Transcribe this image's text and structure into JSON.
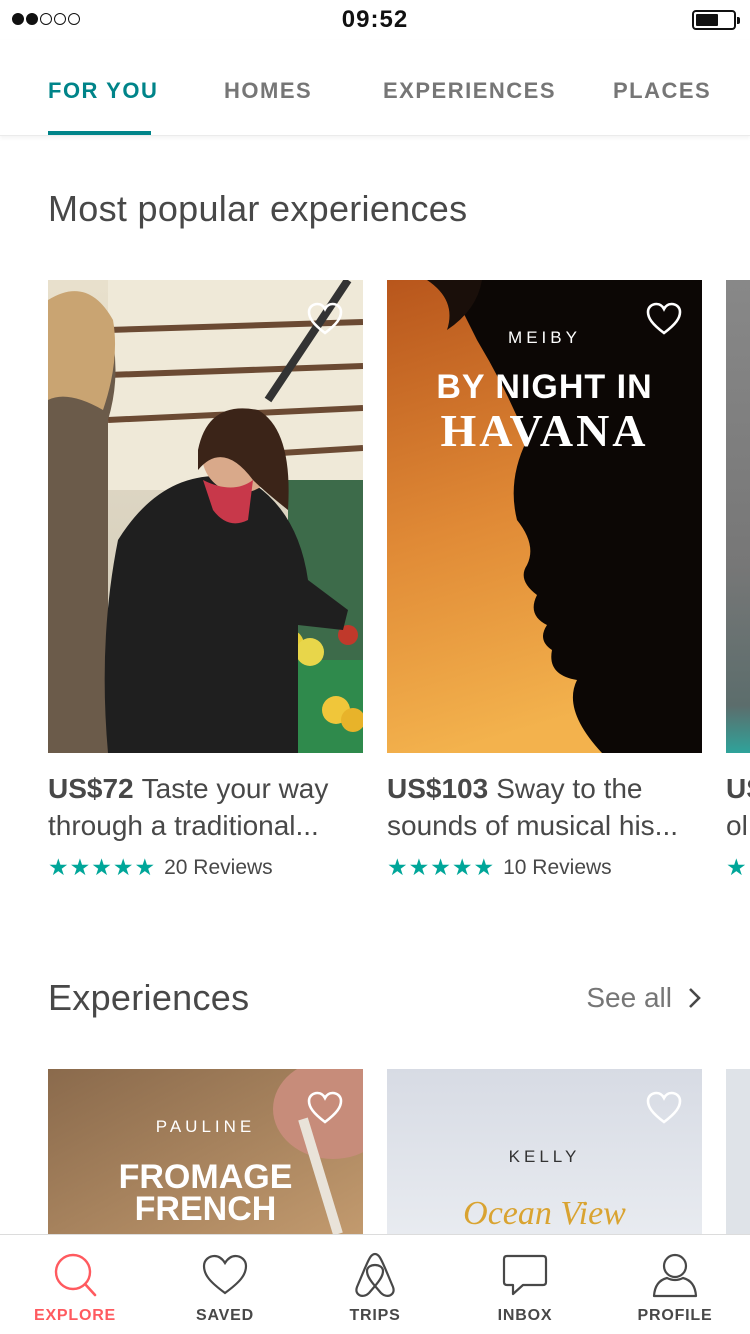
{
  "status_bar": {
    "time": "09:52"
  },
  "tabs": [
    {
      "label": "FOR YOU",
      "active": true
    },
    {
      "label": "HOMES",
      "active": false
    },
    {
      "label": "EXPERIENCES",
      "active": false
    },
    {
      "label": "PLACES",
      "active": false
    }
  ],
  "popular": {
    "title": "Most popular experiences",
    "cards": [
      {
        "price": "US$72",
        "title": "Taste your way through a traditional...",
        "stars": "★★★★★",
        "reviews": "20 Reviews"
      },
      {
        "price": "US$103",
        "title": "Sway to the sounds of musical his...",
        "stars": "★★★★★",
        "reviews": "10 Reviews",
        "host": "MEIBY",
        "line1": "BY NIGHT IN",
        "line2": "HAVANA"
      }
    ],
    "peek": {
      "price": "US",
      "title": "ol"
    }
  },
  "experiences": {
    "title": "Experiences",
    "see_all": "See all",
    "cards": [
      {
        "host": "PAULINE",
        "line1": "FROMAGE",
        "line2": "FRENCH"
      },
      {
        "host": "KELLY",
        "script": "Ocean View"
      }
    ]
  },
  "bottom_nav": [
    {
      "label": "EXPLORE",
      "icon": "search-icon",
      "active": true
    },
    {
      "label": "SAVED",
      "icon": "heart-icon",
      "active": false
    },
    {
      "label": "TRIPS",
      "icon": "airbnb-logo-icon",
      "active": false
    },
    {
      "label": "INBOX",
      "icon": "message-icon",
      "active": false
    },
    {
      "label": "PROFILE",
      "icon": "user-icon",
      "active": false
    }
  ],
  "colors": {
    "accent": "#008489",
    "stars": "#00a699",
    "brand": "#ff5a5f",
    "text": "#484848"
  }
}
